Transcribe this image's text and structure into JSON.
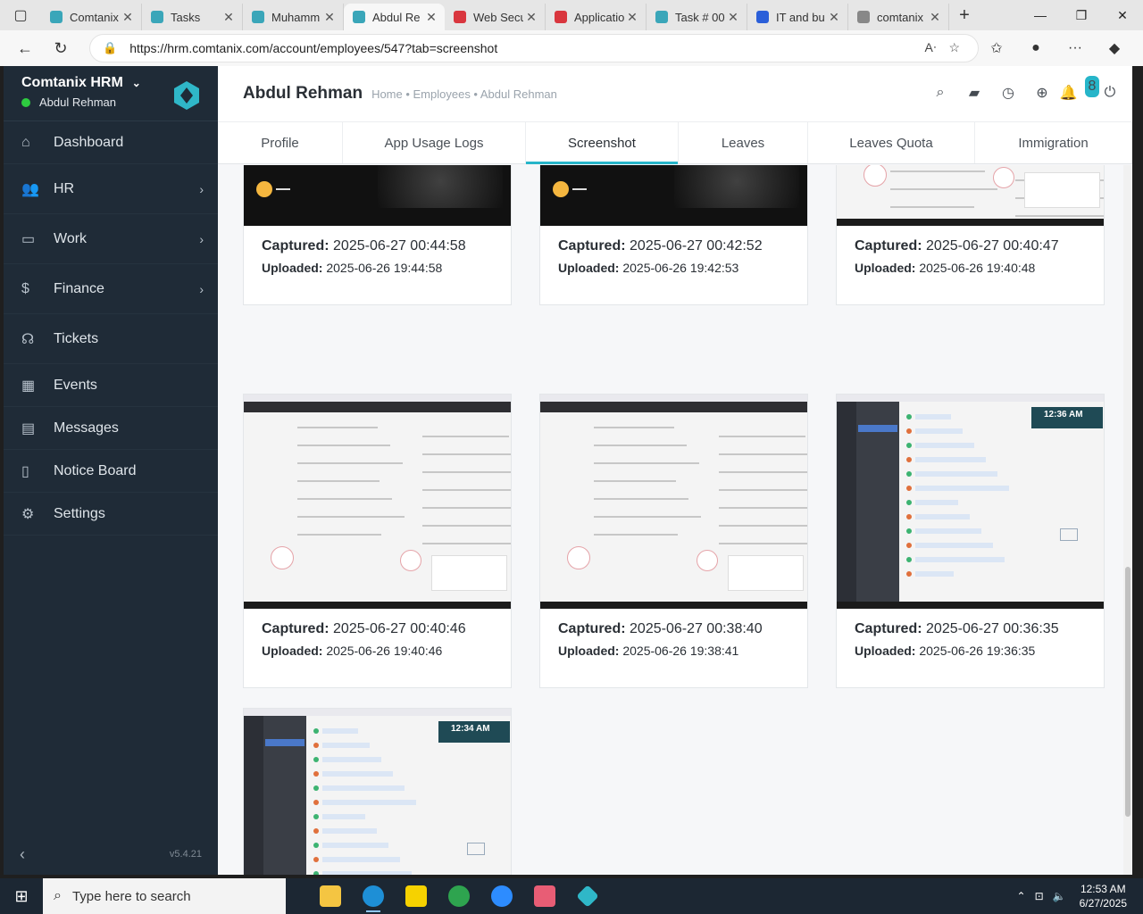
{
  "browser": {
    "tabs": [
      {
        "title": "Comtanix",
        "color": "#3aa6b9"
      },
      {
        "title": "Tasks",
        "color": "#3aa6b9"
      },
      {
        "title": "Muhamm",
        "color": "#3aa6b9"
      },
      {
        "title": "Abdul Re",
        "color": "#3aa6b9",
        "active": true
      },
      {
        "title": "Web Secu",
        "color": "#d9363e"
      },
      {
        "title": "Applicatio",
        "color": "#d9363e"
      },
      {
        "title": "Task # 00",
        "color": "#3aa6b9"
      },
      {
        "title": "IT and bu",
        "color": "#2b5fd9"
      },
      {
        "title": "comtanix",
        "color": "#888888"
      }
    ],
    "url": "https://hrm.comtanix.com/account/employees/547?tab=screenshot"
  },
  "sidebar": {
    "brand": "Comtanix HRM",
    "user": "Abdul Rehman",
    "items": [
      {
        "label": "Dashboard",
        "icon": "home-icon",
        "glyph": "⌂",
        "arrow": false
      },
      {
        "label": "HR",
        "icon": "people-icon",
        "glyph": "👥",
        "arrow": true
      },
      {
        "label": "Work",
        "icon": "briefcase-icon",
        "glyph": "▭",
        "arrow": true
      },
      {
        "label": "Finance",
        "icon": "dollar-icon",
        "glyph": "$",
        "arrow": true
      },
      {
        "label": "Tickets",
        "icon": "headset-icon",
        "glyph": "☊",
        "arrow": false
      },
      {
        "label": "Events",
        "icon": "calendar-icon",
        "glyph": "▦",
        "arrow": false
      },
      {
        "label": "Messages",
        "icon": "chat-icon",
        "glyph": "▤",
        "arrow": false
      },
      {
        "label": "Notice Board",
        "icon": "clipboard-icon",
        "glyph": "▯",
        "arrow": false
      },
      {
        "label": "Settings",
        "icon": "gear-icon",
        "glyph": "⚙",
        "arrow": false
      }
    ],
    "version": "v5.4.21"
  },
  "header": {
    "title": "Abdul Rehman",
    "breadcrumb": "Home • Employees • Abdul Rehman",
    "notification_count": "8"
  },
  "profile_tabs": [
    "Profile",
    "App Usage Logs",
    "Screenshot",
    "Leaves",
    "Leaves Quota",
    "Immigration"
  ],
  "active_tab": "Screenshot",
  "labels": {
    "captured": "Captured:",
    "uploaded": "Uploaded:"
  },
  "screenshots": [
    {
      "captured": "2025-06-27 00:44:58",
      "uploaded": "2025-06-26 19:44:58",
      "kind": "lockscreen"
    },
    {
      "captured": "2025-06-27 00:42:52",
      "uploaded": "2025-06-26 19:42:53",
      "kind": "lockscreen"
    },
    {
      "captured": "2025-06-27 00:40:47",
      "uploaded": "2025-06-26 19:40:48",
      "kind": "webpage"
    },
    {
      "captured": "2025-06-27 00:40:46",
      "uploaded": "2025-06-26 19:40:46",
      "kind": "webpage"
    },
    {
      "captured": "2025-06-27 00:38:40",
      "uploaded": "2025-06-26 19:38:41",
      "kind": "webpage"
    },
    {
      "captured": "2025-06-27 00:36:35",
      "uploaded": "2025-06-26 19:36:35",
      "kind": "chat",
      "clock": "12:36 AM"
    },
    {
      "captured": "",
      "uploaded": "",
      "kind": "chat",
      "clock": "12:34 AM"
    }
  ],
  "taskbar": {
    "search_placeholder": "Type here to search",
    "time": "12:53 AM",
    "date": "6/27/2025"
  }
}
